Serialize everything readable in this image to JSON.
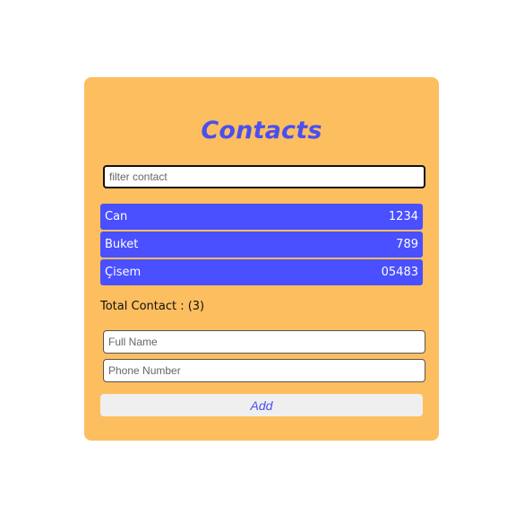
{
  "app": {
    "title": "Contacts"
  },
  "filter": {
    "placeholder": "filter contact",
    "value": ""
  },
  "contacts": [
    {
      "name": "Can",
      "phone": "1234"
    },
    {
      "name": "Buket",
      "phone": "789"
    },
    {
      "name": "Çisem",
      "phone": "05483"
    }
  ],
  "total": {
    "text": "Total Contact : (3)"
  },
  "form": {
    "full_name_placeholder": "Full Name",
    "phone_placeholder": "Phone Number",
    "add_label": "Add"
  },
  "colors": {
    "card_background": "#fdbe5f",
    "accent": "#4a4fff",
    "title": "#4a4fef",
    "button_background": "#efefef"
  }
}
